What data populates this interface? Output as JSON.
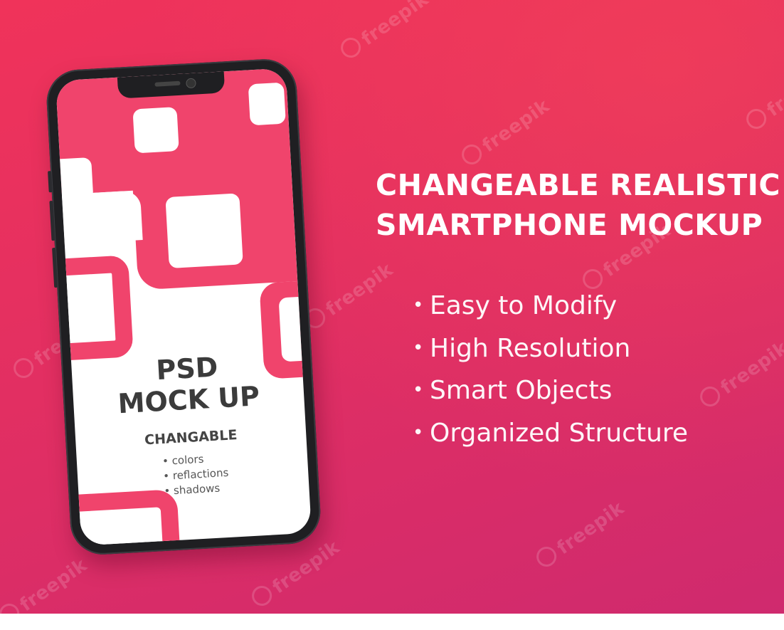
{
  "watermark": {
    "text": "freepik"
  },
  "headline": {
    "line1": "CHANGEABLE REALISTIC",
    "line2": "SMARTPHONE MOCKUP"
  },
  "features": [
    {
      "label": "Easy to Modify"
    },
    {
      "label": "High Resolution"
    },
    {
      "label": "Smart Objects"
    },
    {
      "label": "Organized Structure"
    }
  ],
  "phone_screen": {
    "title_line1": "PSD",
    "title_line2": "MOCK UP",
    "subtitle": "CHANGABLE",
    "options": [
      "colors",
      "reflactions",
      "shadows"
    ]
  },
  "colors": {
    "background_start": "#f0335a",
    "background_end": "#cf2a6e",
    "screen_accent": "#f0446c",
    "text_light": "#ffffff",
    "text_dark": "#3b3b3b"
  }
}
